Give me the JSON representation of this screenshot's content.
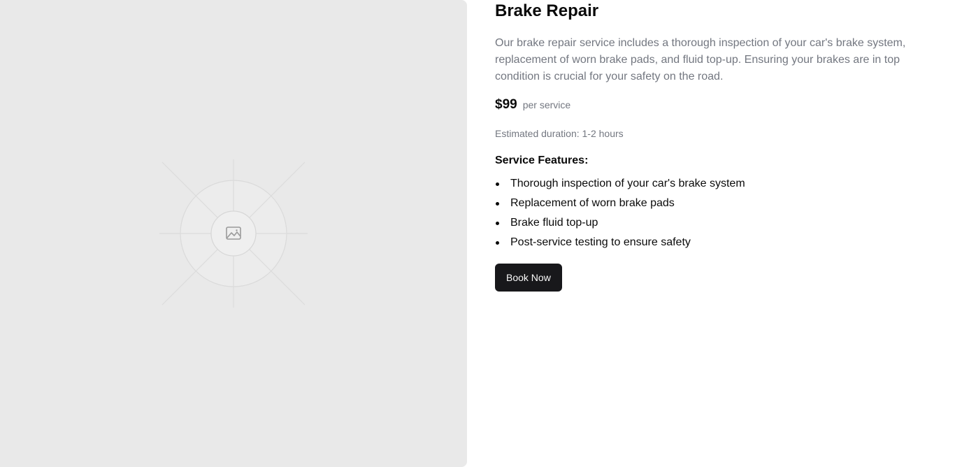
{
  "service": {
    "title": "Brake Repair",
    "description": "Our brake repair service includes a thorough inspection of your car's brake system, replacement of worn brake pads, and fluid top-up. Ensuring your brakes are in top condition is crucial for your safety on the road.",
    "price": "$99",
    "price_unit": "per service",
    "duration": "Estimated duration: 1-2 hours",
    "features_heading": "Service Features:",
    "features": [
      "Thorough inspection of your car's brake system",
      "Replacement of worn brake pads",
      "Brake fluid top-up",
      "Post-service testing to ensure safety"
    ],
    "book_label": "Book Now"
  },
  "image": {
    "icon": "image-placeholder-icon"
  },
  "colors": {
    "placeholder_bg": "#e9e9e9",
    "button_bg": "#18181b",
    "muted_text": "#737780"
  }
}
